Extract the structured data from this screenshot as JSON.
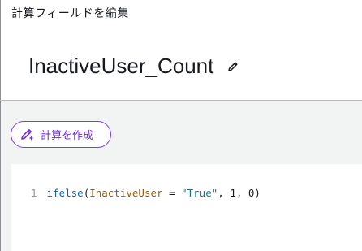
{
  "dialog": {
    "title": "計算フィールドを編集",
    "field_name": "InactiveUser_Count"
  },
  "toolbar": {
    "create_calc_label": "計算を作成"
  },
  "editor": {
    "line_number": "1",
    "tokens": {
      "fn": "ifelse",
      "open_paren": "(",
      "field": "InactiveUser",
      "equals": " = ",
      "string": "\"True\"",
      "rest": ", 1, 0)"
    }
  },
  "icons": {
    "edit_name": "pencil-icon",
    "create_calc": "sparkle-pencil-icon"
  },
  "colors": {
    "accent_purple": "#7c3aed",
    "function": "#0b66b6",
    "field": "#a15c00",
    "string": "#008094"
  }
}
